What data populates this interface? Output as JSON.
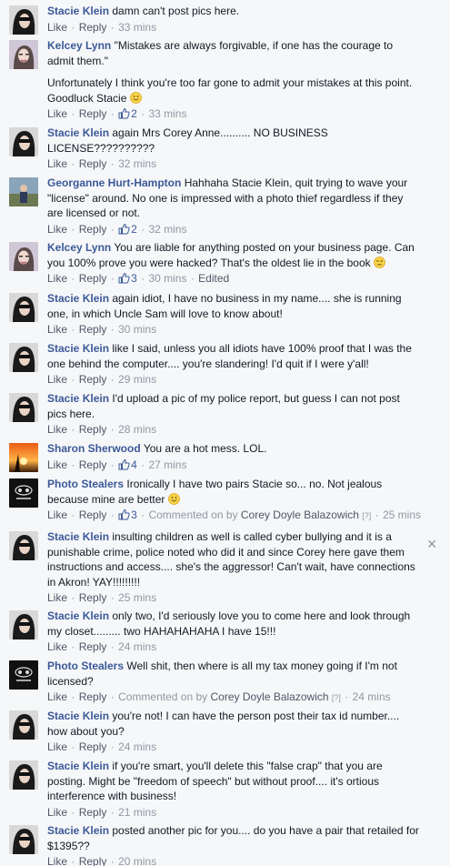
{
  "labels": {
    "like": "Like",
    "reply": "Reply",
    "edited": "Edited",
    "commented_on_by": "Commented on by",
    "sep": "·"
  },
  "comments": [
    {
      "author": "Stacie Klein",
      "text": "damn can't post pics here.",
      "likes": "",
      "time": "33 mins",
      "avatar": "stacie"
    },
    {
      "author": "Kelcey Lynn",
      "text": "\"Mistakes are always forgivable, if one has the courage to admit them.\"",
      "text2": "Unfortunately I think you're too far gone to admit your mistakes at this point. Goodluck Stacie",
      "likes": "2",
      "time": "33 mins",
      "avatar": "kelcey"
    },
    {
      "author": "Stacie Klein",
      "text": "again Mrs Corey Anne.......... NO BUSINESS LICENSE??????????",
      "likes": "",
      "time": "32 mins",
      "avatar": "stacie"
    },
    {
      "author": "Georganne Hurt-Hampton",
      "text": "Hahhaha Stacie Klein, quit trying to wave your \"license\" around. No one is impressed with a photo thief regardless if they are licensed or not.",
      "likes": "2",
      "time": "32 mins",
      "avatar": "georganne"
    },
    {
      "author": "Kelcey Lynn",
      "text": "You are liable for anything posted on your business page. Can you 100% prove you were hacked? That's the oldest lie in the book",
      "likes": "3",
      "time": "30 mins",
      "avatar": "kelcey"
    },
    {
      "author": "Stacie Klein",
      "text": "again idiot, I have no business in my name.... she is running one, in which Uncle Sam will love to know about!",
      "likes": "",
      "time": "30 mins",
      "avatar": "stacie"
    },
    {
      "author": "Stacie Klein",
      "text": "like I said, unless you all idiots have 100% proof that I was the one behind the computer.... you're slandering! I'd quit if I were y'all!",
      "likes": "",
      "time": "29 mins",
      "avatar": "stacie"
    },
    {
      "author": "Stacie Klein",
      "text": "I'd upload a pic of my police report, but guess I can not post pics here.",
      "likes": "",
      "time": "28 mins",
      "avatar": "stacie"
    },
    {
      "author": "Sharon Sherwood",
      "text": "You are a hot mess. LOL.",
      "likes": "4",
      "time": "27 mins",
      "avatar": "sharon"
    },
    {
      "author": "Photo Stealers",
      "text": "Ironically I have two pairs Stacie so... no. Not jealous because mine are better",
      "likes": "3",
      "commented_by": "Corey Doyle Balazowich",
      "q": "[?]",
      "time": "25 mins",
      "avatar": "photo"
    },
    {
      "author": "Stacie Klein",
      "text": "insulting children as well is called cyber bullying and it is a punishable crime, police noted who did it and since Corey here gave them instructions and access.... she's the aggressor! Can't wait, have connections in Akron! YAY!!!!!!!!!",
      "likes": "",
      "time": "25 mins",
      "avatar": "stacie",
      "close": "✕"
    },
    {
      "author": "Stacie Klein",
      "text": "only two, I'd seriously love you to come here and look through my closet......... two HAHAHAHAHA I have 15!!!",
      "likes": "",
      "time": "24 mins",
      "avatar": "stacie"
    },
    {
      "author": "Photo Stealers",
      "text": "Well shit, then where is all my tax money going if I'm not licensed?",
      "likes": "",
      "commented_by": "Corey Doyle Balazowich",
      "q": "[?]",
      "time": "24 mins",
      "avatar": "photo"
    },
    {
      "author": "Stacie Klein",
      "text": "you're not! I can have the person post their tax id number.... how about you?",
      "likes": "",
      "time": "24 mins",
      "avatar": "stacie"
    },
    {
      "author": "Stacie Klein",
      "text": "if you're smart, you'll delete this \"false crap\" that you are posting. Might be \"freedom of speech\" but without proof.... it's ortious interference with business!",
      "likes": "",
      "time": "21 mins",
      "avatar": "stacie"
    },
    {
      "author": "Stacie Klein",
      "text": "posted another pic for you.... do you have a pair that retailed for $1395??",
      "likes": "",
      "time": "20 mins",
      "avatar": "stacie"
    }
  ]
}
